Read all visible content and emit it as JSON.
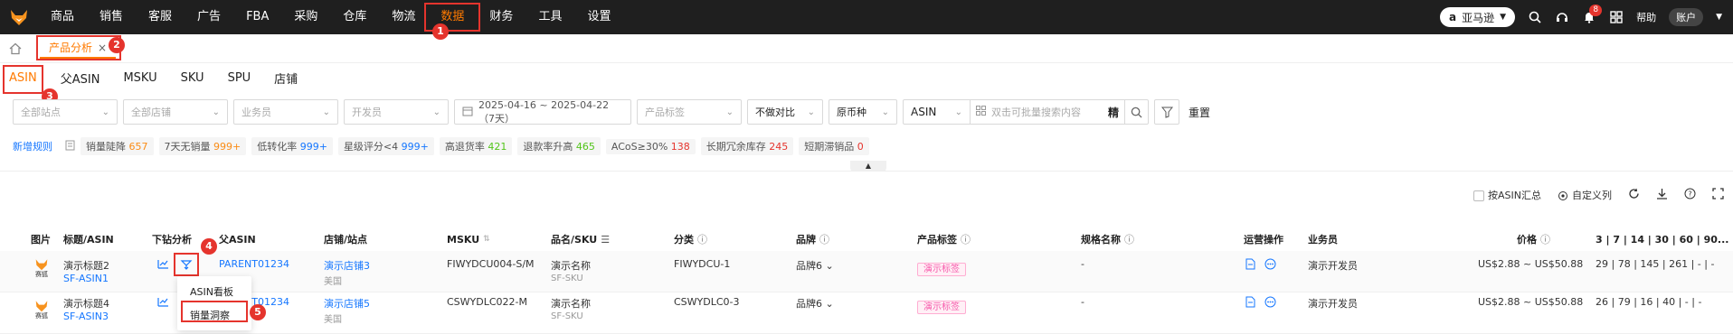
{
  "nav": {
    "items": [
      "商品",
      "销售",
      "客服",
      "广告",
      "FBA",
      "采购",
      "仓库",
      "物流",
      "数据",
      "财务",
      "工具",
      "设置"
    ],
    "active_index": 8
  },
  "topright": {
    "marketplace": "亚马逊",
    "notification_count": "8",
    "help": "帮助",
    "account": "账户"
  },
  "tabbar": {
    "tab_label": "产品分析",
    "close": "×"
  },
  "steps": [
    "1",
    "2",
    "3",
    "4",
    "5"
  ],
  "subtabs": [
    "ASIN",
    "父ASIN",
    "MSKU",
    "SKU",
    "SPU",
    "店铺"
  ],
  "filters": {
    "site": "全部站点",
    "store": "全部店铺",
    "salesperson": "业务员",
    "developer": "开发员",
    "date_range": "2025-04-16 ~ 2025-04-22（7天）",
    "product_tag": "产品标签",
    "compare": "不做对比",
    "currency": "原币种",
    "search_type": "ASIN",
    "search_placeholder": "双击可批量搜索内容",
    "exact": "精",
    "reset": "重置"
  },
  "rules": {
    "new_rule": "新增规则",
    "tags": [
      {
        "label": "销量陡降",
        "count": "657",
        "color": "orange"
      },
      {
        "label": "7天无销量",
        "count": "999+",
        "color": "orange"
      },
      {
        "label": "低转化率",
        "count": "999+",
        "color": "blue"
      },
      {
        "label": "星级评分<4",
        "count": "999+",
        "color": "blue"
      },
      {
        "label": "高退货率",
        "count": "421",
        "color": "green"
      },
      {
        "label": "退款率升高",
        "count": "465",
        "color": "green"
      },
      {
        "label": "ACoS≥30%",
        "count": "138",
        "color": "red"
      },
      {
        "label": "长期冗余库存",
        "count": "245",
        "color": "red"
      },
      {
        "label": "短期滞销品",
        "count": "0",
        "color": "red"
      }
    ]
  },
  "toolbar": {
    "summary_toggle": "按ASIN汇总",
    "custom_columns": "自定义列"
  },
  "table": {
    "headers": {
      "image": "图片",
      "title_asin": "标题/ASIN",
      "drilldown": "下钻分析",
      "parent_asin": "父ASIN",
      "store_site": "店铺/站点",
      "msku": "MSKU",
      "name_sku": "品名/SKU",
      "category": "分类",
      "brand": "品牌",
      "product_tag": "产品标签",
      "spec": "规格名称",
      "operation": "运营操作",
      "salesperson": "业务员",
      "price": "价格",
      "periods": "3 | 7 | 14 | 30 | 60 | 90..."
    },
    "rows": [
      {
        "thumb_label": "赛狐",
        "title": "演示标题2",
        "asin": "SF-ASIN1",
        "parent_asin": "PARENT01234",
        "store": "演示店铺3",
        "site": "美国",
        "msku": "FIWYDCU004-S/M",
        "name": "演示名称",
        "sku": "SF-SKU",
        "category": "FIWYDCU-1",
        "brand": "品牌6",
        "tag": "演示标签",
        "spec": "-",
        "salesperson": "演示开发员",
        "price": "US$2.88 ~ US$50.88",
        "periods": "29 | 78 | 145 | 261 | - | -"
      },
      {
        "thumb_label": "赛狐",
        "title": "演示标题4",
        "asin": "SF-ASIN3",
        "parent_asin": "PARENT01234",
        "store": "演示店铺5",
        "site": "美国",
        "msku": "CSWYDLC022-M",
        "name": "演示名称",
        "sku": "SF-SKU",
        "category": "CSWYDLC0-3",
        "brand": "品牌6",
        "tag": "演示标签",
        "spec": "-",
        "salesperson": "演示开发员",
        "price": "US$2.88 ~ US$50.88",
        "periods": "26 | 79 | 16 | 40 | - | -"
      }
    ]
  },
  "popup": {
    "items": [
      "ASIN看板",
      "销量洞察"
    ]
  }
}
